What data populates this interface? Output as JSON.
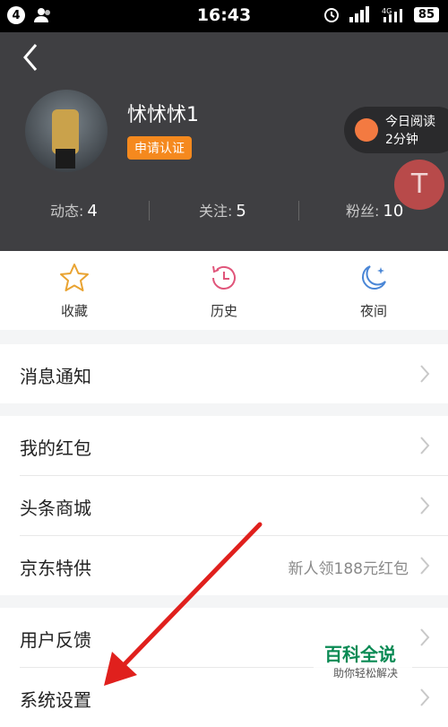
{
  "status_bar": {
    "left_badge": "4",
    "time": "16:43",
    "battery": "85",
    "network": "4G"
  },
  "profile": {
    "username": "怵怵怵1",
    "cert_label": "申请认证"
  },
  "reading": {
    "line1": "今日阅读",
    "line2": "2分钟"
  },
  "floating_badge": "T",
  "stats": [
    {
      "label": "动态:",
      "value": "4"
    },
    {
      "label": "关注:",
      "value": "5"
    },
    {
      "label": "粉丝:",
      "value": "10"
    }
  ],
  "quick_actions": [
    {
      "label": "收藏",
      "icon": "star-icon"
    },
    {
      "label": "历史",
      "icon": "clock-icon"
    },
    {
      "label": "夜间",
      "icon": "moon-icon"
    }
  ],
  "menu_group1": [
    {
      "label": "消息通知",
      "value": ""
    }
  ],
  "menu_group2": [
    {
      "label": "我的红包",
      "value": ""
    },
    {
      "label": "头条商城",
      "value": ""
    },
    {
      "label": "京东特供",
      "value": "新人领188元红包"
    }
  ],
  "menu_group3": [
    {
      "label": "用户反馈",
      "value": ""
    },
    {
      "label": "系统设置",
      "value": ""
    }
  ],
  "watermark": {
    "title": "百科全说",
    "subtitle": "助你轻松解决"
  },
  "colors": {
    "accent": "#f5891e",
    "header_bg": "#3f3f42",
    "arrow": "#e0201d"
  }
}
